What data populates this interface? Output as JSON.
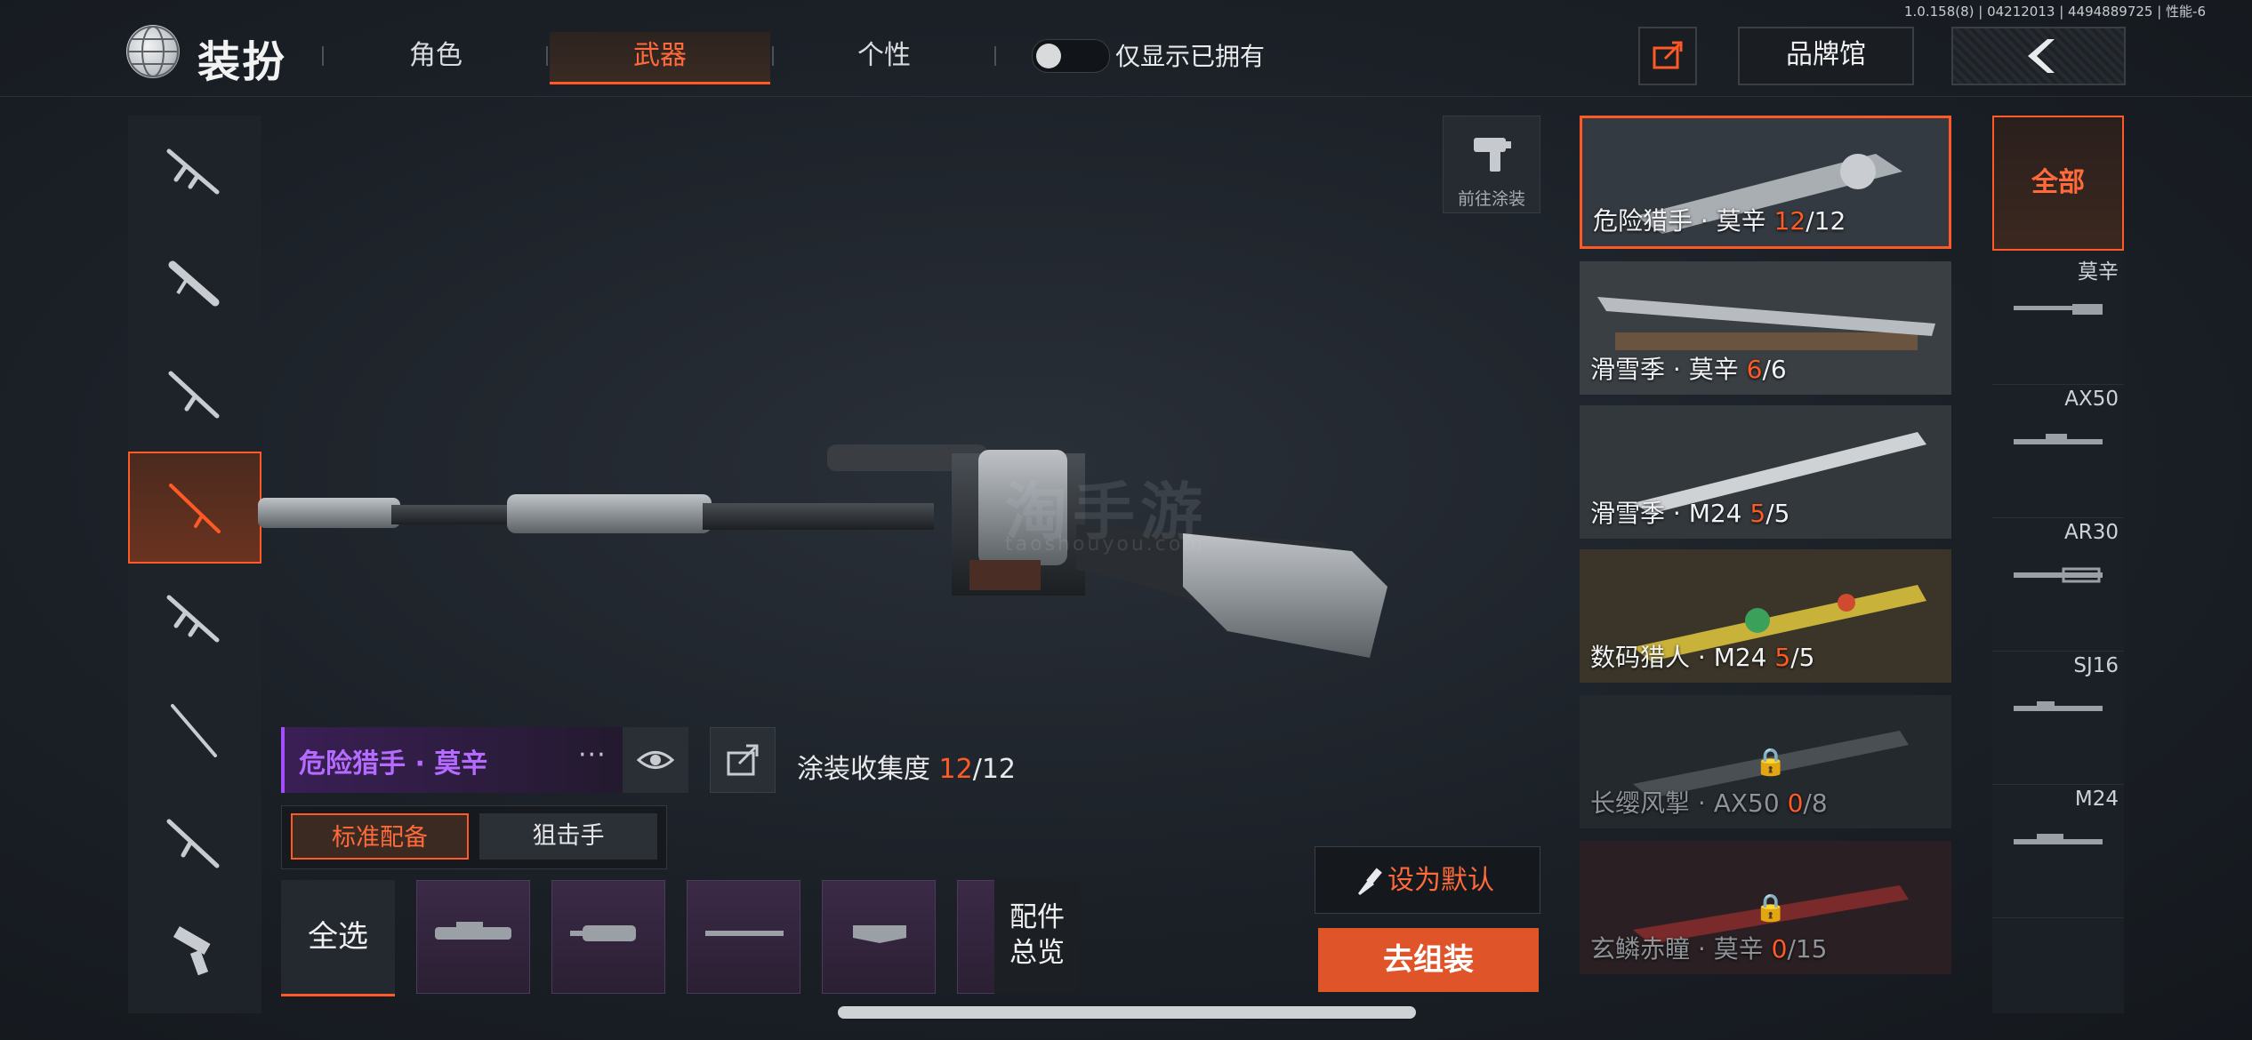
{
  "header": {
    "version": "1.0.158(8) | 04212013 | 4494889725 | 性能-6",
    "title": "装扮",
    "tabs": [
      {
        "label": "角色"
      },
      {
        "label": "武器"
      },
      {
        "label": "个性"
      }
    ],
    "active_tab": "武器",
    "toggle_label": "仅显示已拥有",
    "brand_label": "品牌馆"
  },
  "weapon_nav": {
    "items": [
      "assault-rifle-icon",
      "smg-icon",
      "shotgun-icon",
      "sniper-rifle-icon",
      "rifle-icon",
      "marksman-rifle-icon",
      "carbine-icon",
      "pistol-icon"
    ],
    "active_index": 3
  },
  "preview": {
    "watermark": "淘手游",
    "watermark_url": "taoshouyou.com",
    "goto_paint_label": "前往涂装"
  },
  "skin_info": {
    "name": "危险猎手 · 莫辛",
    "more": "···",
    "collection_label": "涂装收集度",
    "collected": "12",
    "total": "/12"
  },
  "loadout_tabs": [
    "标准配备",
    "狙击手"
  ],
  "parts": {
    "select_all": "全选",
    "overview_line1": "配件",
    "overview_line2": "总览"
  },
  "actions": {
    "set_default": "设为默认",
    "go_assemble": "去组装"
  },
  "skins": [
    {
      "prefix": "危险猎手 · 莫辛 ",
      "count": "12",
      "total": "/12",
      "locked": false,
      "selected": true
    },
    {
      "prefix": "滑雪季 · 莫辛 ",
      "count": "6",
      "total": "/6",
      "locked": false,
      "selected": false
    },
    {
      "prefix": "滑雪季 · M24 ",
      "count": "5",
      "total": "/5",
      "locked": false,
      "selected": false
    },
    {
      "prefix": "数码猎人 · M24 ",
      "count": "5",
      "total": "/5",
      "locked": false,
      "selected": false
    },
    {
      "prefix": "长缨风掣 · AX50 ",
      "count": "0",
      "total": "/8",
      "locked": true,
      "selected": false
    },
    {
      "prefix": "玄鳞赤瞳 · 莫辛 ",
      "count": "0",
      "total": "/15",
      "locked": true,
      "selected": false
    }
  ],
  "filter": {
    "all_label": "全部",
    "items": [
      "莫辛",
      "AX50",
      "AR30",
      "SJ16",
      "M24"
    ]
  },
  "colors": {
    "accent": "#ff5a26",
    "rare_purple": "#b56bff",
    "background": "#1b2027"
  }
}
